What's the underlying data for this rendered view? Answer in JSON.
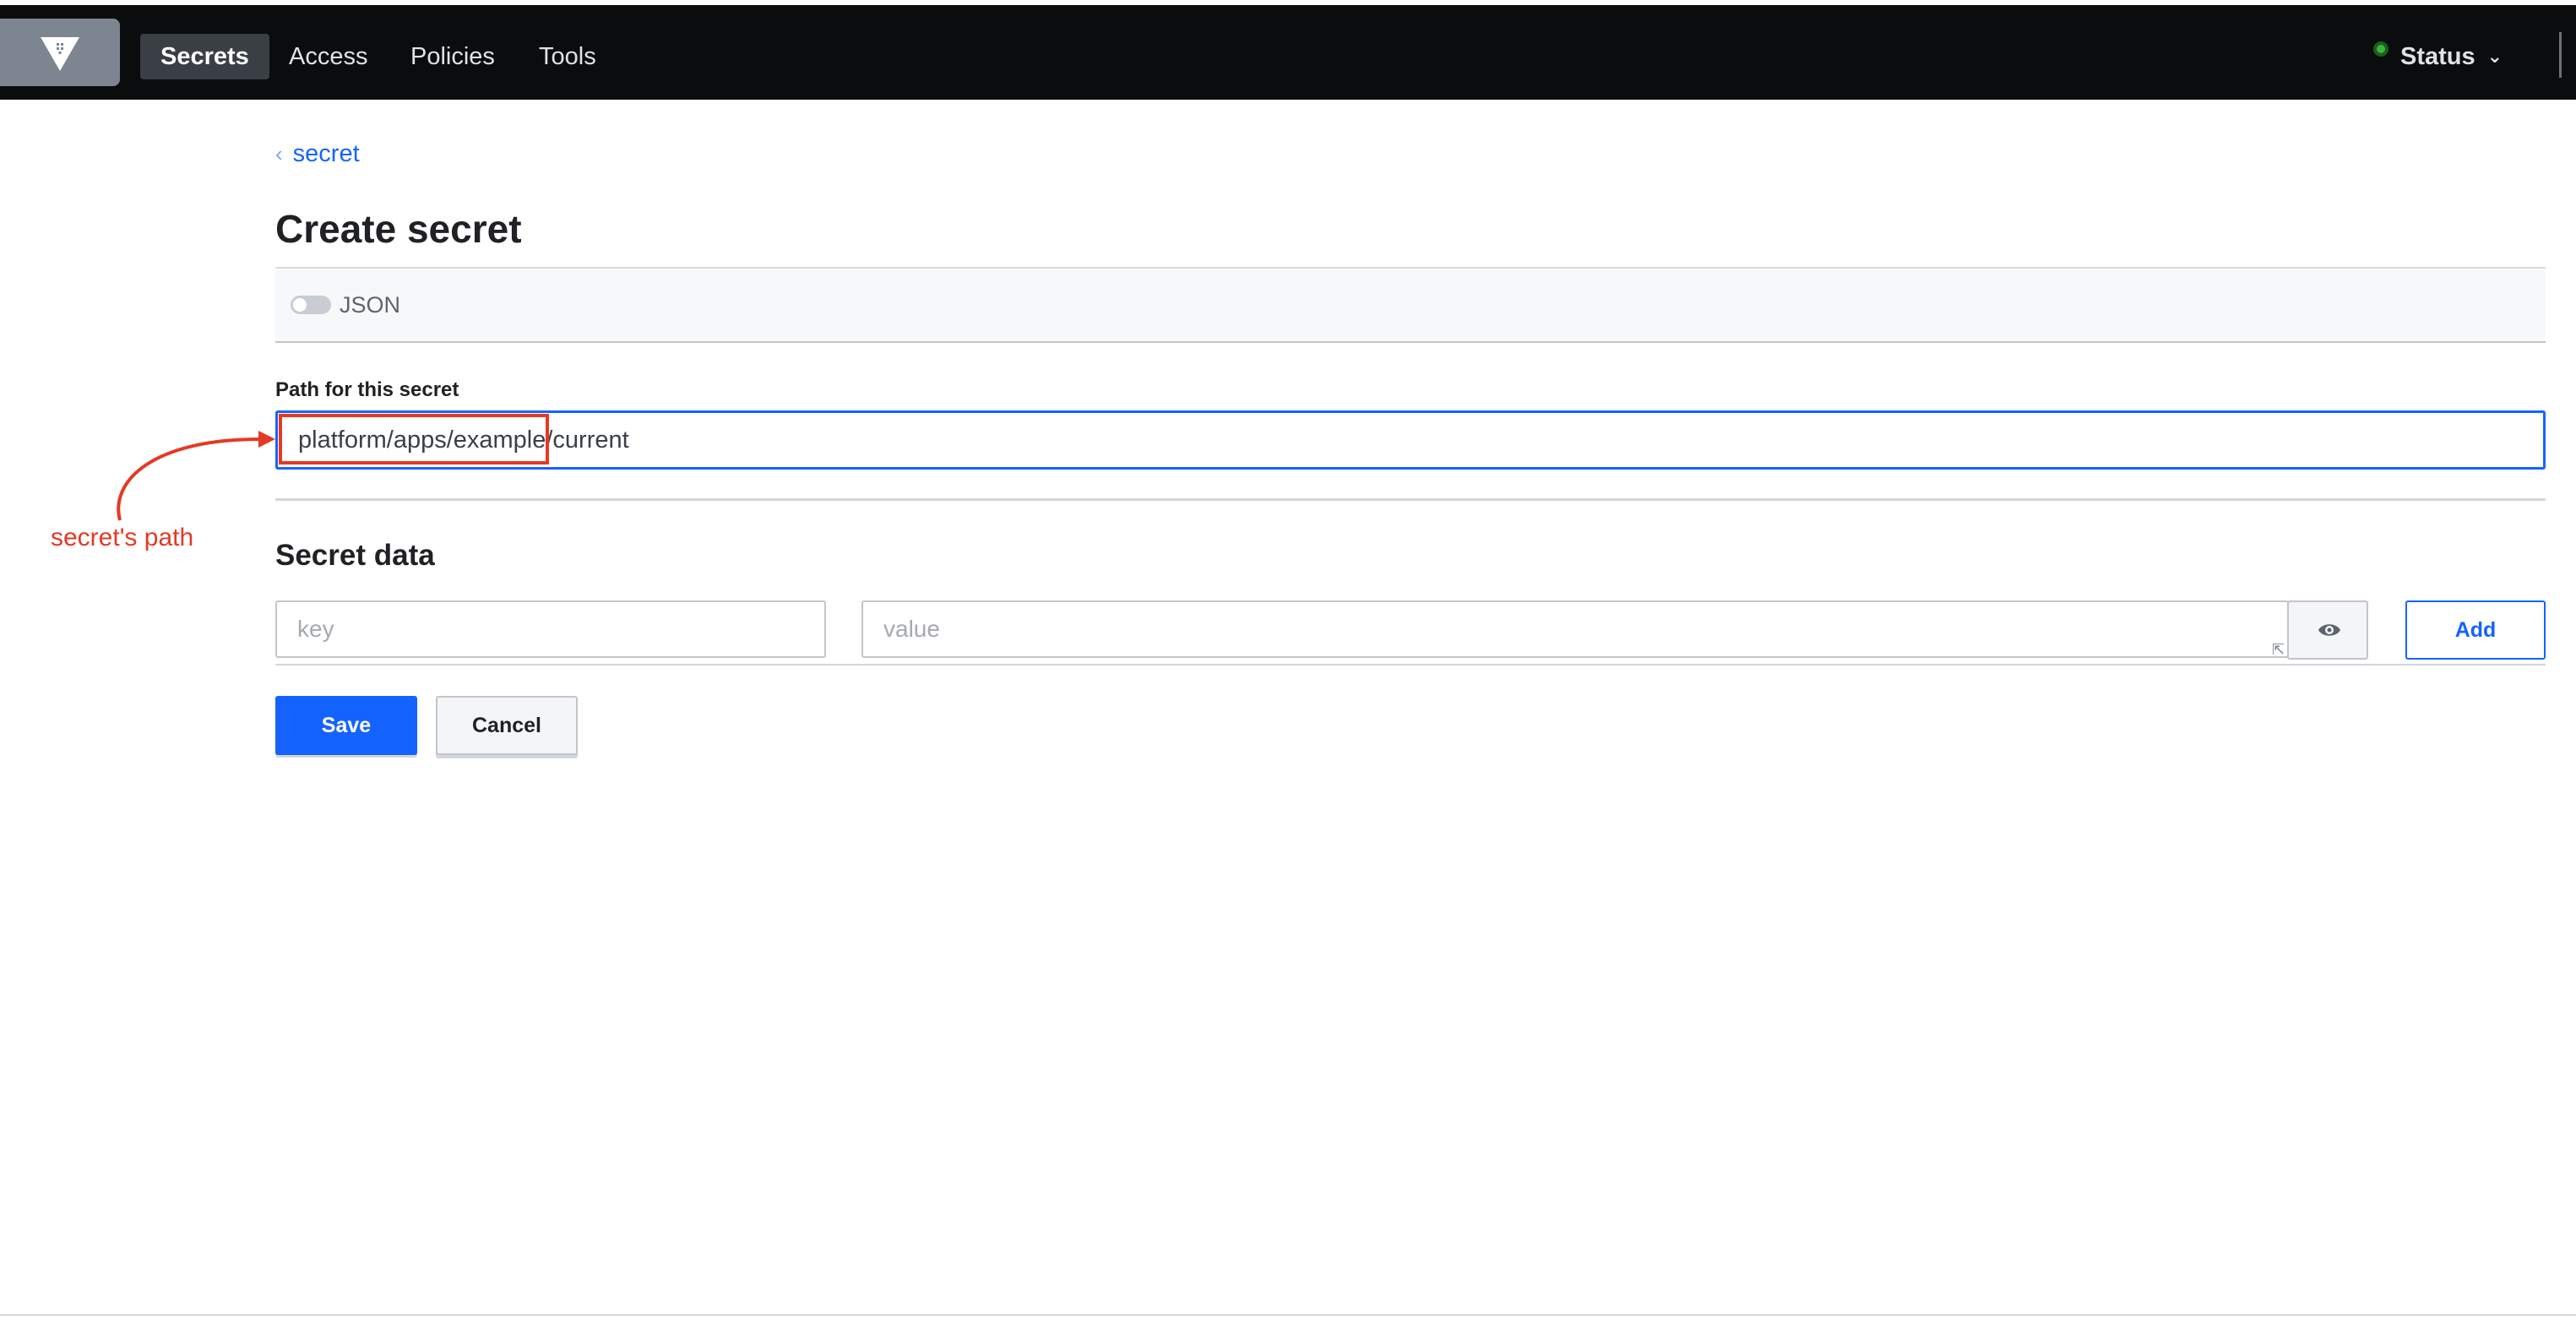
{
  "nav": {
    "items": [
      "Secrets",
      "Access",
      "Policies",
      "Tools"
    ],
    "active": "Secrets",
    "status_label": "Status",
    "status_color": "#3bb33b"
  },
  "breadcrumb": {
    "label": "secret"
  },
  "page": {
    "title": "Create secret"
  },
  "json_toggle": {
    "label": "JSON",
    "on": false
  },
  "path_field": {
    "label": "Path for this secret",
    "value": "platform/apps/example/current"
  },
  "secret_data": {
    "title": "Secret data",
    "key_placeholder": "key",
    "value_placeholder": "value",
    "add_label": "Add"
  },
  "actions": {
    "save_label": "Save",
    "cancel_label": "Cancel"
  },
  "annotation": {
    "text": "secret's path",
    "color": "#e53925"
  },
  "colors": {
    "accent": "#1563ff",
    "nav_bg": "#0b0c0d"
  }
}
